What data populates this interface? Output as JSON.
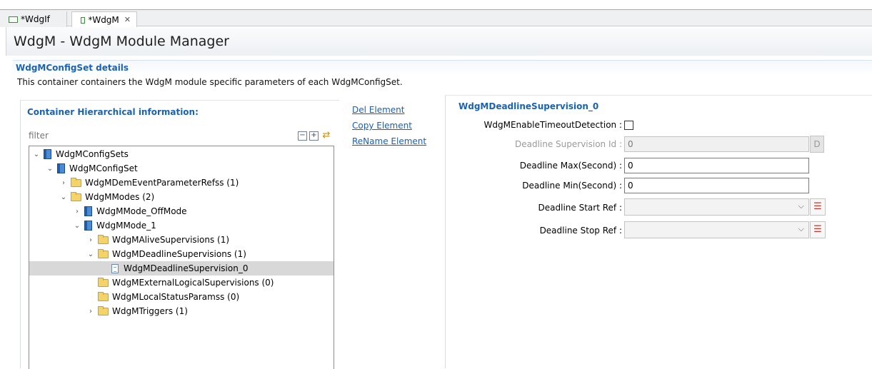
{
  "tabs": [
    {
      "label": "*WdgIf",
      "active": false
    },
    {
      "label": "*WdgM",
      "active": true,
      "close_icon": "close-icon"
    }
  ],
  "header": {
    "title": "WdgM - WdgM Module Manager"
  },
  "section": {
    "title": "WdgMConfigSet details",
    "description": "This container containers the WdgM module specific parameters of each WdgMConfigSet."
  },
  "left_panel": {
    "title": "Container Hierarchical information:",
    "filter_placeholder": "filter",
    "tools": [
      "collapse-all-icon",
      "expand-all-icon",
      "sync-icon"
    ],
    "tree": [
      {
        "label": "WdgMConfigSets",
        "level": 0,
        "expander": "expanded",
        "icon": "book-icon"
      },
      {
        "label": "WdgMConfigSet",
        "level": 1,
        "expander": "expanded",
        "icon": "book-icon"
      },
      {
        "label": "WdgMDemEventParameterRefss (1)",
        "level": 2,
        "expander": "collapsed",
        "icon": "folder-icon"
      },
      {
        "label": "WdgMModes (2)",
        "level": 2,
        "expander": "expanded",
        "icon": "folder-icon"
      },
      {
        "label": "WdgMMode_OffMode",
        "level": 3,
        "expander": "collapsed",
        "icon": "book-icon"
      },
      {
        "label": "WdgMMode_1",
        "level": 3,
        "expander": "expanded",
        "icon": "book-icon"
      },
      {
        "label": "WdgMAliveSupervisions (1)",
        "level": 4,
        "expander": "collapsed",
        "icon": "folder-icon"
      },
      {
        "label": "WdgMDeadlineSupervisions (1)",
        "level": 4,
        "expander": "expanded",
        "icon": "folder-icon"
      },
      {
        "label": "WdgMDeadlineSupervision_0",
        "level": 5,
        "expander": "none",
        "icon": "document-icon",
        "selected": true
      },
      {
        "label": "WdgMExternalLogicalSupervisions (0)",
        "level": 4,
        "expander": "none",
        "icon": "folder-icon"
      },
      {
        "label": "WdgMLocalStatusParamss (0)",
        "level": 4,
        "expander": "none",
        "icon": "folder-icon"
      },
      {
        "label": "WdgMTriggers (1)",
        "level": 4,
        "expander": "collapsed",
        "icon": "folder-icon"
      }
    ]
  },
  "actions": {
    "del": "Del Element",
    "copy": "Copy Element",
    "rename": "ReName Element"
  },
  "right_panel": {
    "title": "WdgMDeadlineSupervision_0",
    "enable_timeout_label": "WdgMEnableTimeoutDetection :",
    "enable_timeout_checked": false,
    "supervision_id_label": "Deadline Supervision Id :",
    "supervision_id_value": "0",
    "supervision_id_btn": "D",
    "max_label": "Deadline Max(Second) :",
    "max_value": "0",
    "min_label": "Deadline Min(Second) :",
    "min_value": "0",
    "start_ref_label": "Deadline Start Ref :",
    "start_ref_value": "",
    "stop_ref_label": "Deadline Stop Ref :",
    "stop_ref_value": ""
  }
}
